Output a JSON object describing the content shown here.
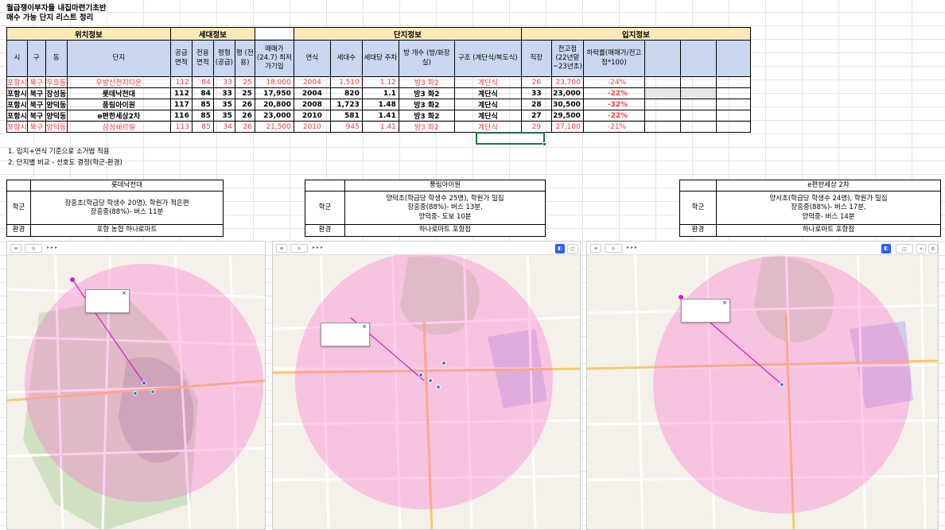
{
  "sheet": {
    "title1": "월급쟁이부자들 내집마련기초반",
    "title2": "매수 가능 단지 리스트 정리"
  },
  "main_table": {
    "groups": [
      "위치정보",
      "세대정보",
      "단지정보",
      "입지정보"
    ],
    "headers": [
      "시",
      "구",
      "동",
      "단지",
      "공급 면적",
      "전용 면적",
      "평형 (공급)",
      "평 (전용)",
      "매매가 (24.7) 최저가기입",
      "연식",
      "세대수",
      "세대당 주차",
      "방 개수 (방/화장실)",
      "구조 (계단식/복도식)",
      "직장",
      "전고점 (22년말 ~23년초)",
      "하락률(매매가/전고점*100)",
      "",
      "",
      ""
    ],
    "rows": [
      {
        "highlight": true,
        "cells": [
          "포항시",
          "북구",
          "두호동",
          "우방신천지타운",
          "112",
          "84",
          "33",
          "25",
          "18,000",
          "2004",
          "1,510",
          "1.12",
          "방3 화2",
          "계단식",
          "26",
          "23,700",
          "-24%"
        ]
      },
      {
        "highlight": false,
        "cells": [
          "포항시",
          "북구",
          "장성동",
          "롯데낙천대",
          "112",
          "84",
          "33",
          "25",
          "17,950",
          "2004",
          "820",
          "1.1",
          "방3 화2",
          "계단식",
          "33",
          "23,000",
          "-22%"
        ]
      },
      {
        "highlight": false,
        "cells": [
          "포항시",
          "북구",
          "양덕동",
          "풍림아이원",
          "117",
          "85",
          "35",
          "26",
          "20,800",
          "2008",
          "1,723",
          "1.48",
          "방3 화2",
          "계단식",
          "28",
          "30,500",
          "-32%"
        ]
      },
      {
        "highlight": false,
        "cells": [
          "포항시",
          "북구",
          "양덕동",
          "e편한세상2차",
          "116",
          "85",
          "35",
          "26",
          "23,000",
          "2010",
          "581",
          "1.41",
          "방3 화2",
          "계단식",
          "27",
          "29,500",
          "-22%"
        ]
      },
      {
        "highlight": true,
        "cells": [
          "포항시",
          "북구",
          "양덕동",
          "삼성쉐르빌",
          "113",
          "85",
          "34",
          "26",
          "21,500",
          "2010",
          "945",
          "1.41",
          "방3 화2",
          "계단식",
          "29",
          "27,100",
          "-21%"
        ]
      }
    ]
  },
  "notes": [
    "1. 입지+연식 기준으로 소거법 적용",
    "2. 단지별 비교 - 선호도 결정(학군-환경)"
  ],
  "comparisons": [
    {
      "name": "롯데낙천대",
      "school_label": "학군",
      "school": [
        "장흥초(학급당 학생수 20명), 학원가 적은편",
        "장흥중(88%)- 버스 11분"
      ],
      "env_label": "환경",
      "env": "포항 농협 하나로마트"
    },
    {
      "name": "풍림아이원",
      "school_label": "학군",
      "school": [
        "양덕초(학급당 학생수 25명), 학원가 밀집",
        "장흥중(88%)- 버스 13분,",
        "양덕중- 도보 10분"
      ],
      "env_label": "환경",
      "env": "하나로마트 포항점"
    },
    {
      "name": "e편한세상 2차",
      "school_label": "학군",
      "school": [
        "양서초(학급당 학생수 24명), 학원가 밀집",
        "장흥중(88%)- 버스 17분,",
        "양덕중- 버스 14분"
      ],
      "env_label": "환경",
      "env": "하나로마트 포항점"
    }
  ],
  "colors": {
    "group_header": "#fde8b8",
    "column_header": "#c9d8f0",
    "highlight_text": "#ff3b3b",
    "radius_circle": "#ff66cc"
  },
  "maps": [
    {
      "name": "map-lotte",
      "icons": [
        "location-pin-icon"
      ]
    },
    {
      "name": "map-punglim",
      "icons": [
        "location-pin-icon"
      ]
    },
    {
      "name": "map-epyunhan",
      "icons": [
        "location-pin-icon"
      ]
    }
  ]
}
